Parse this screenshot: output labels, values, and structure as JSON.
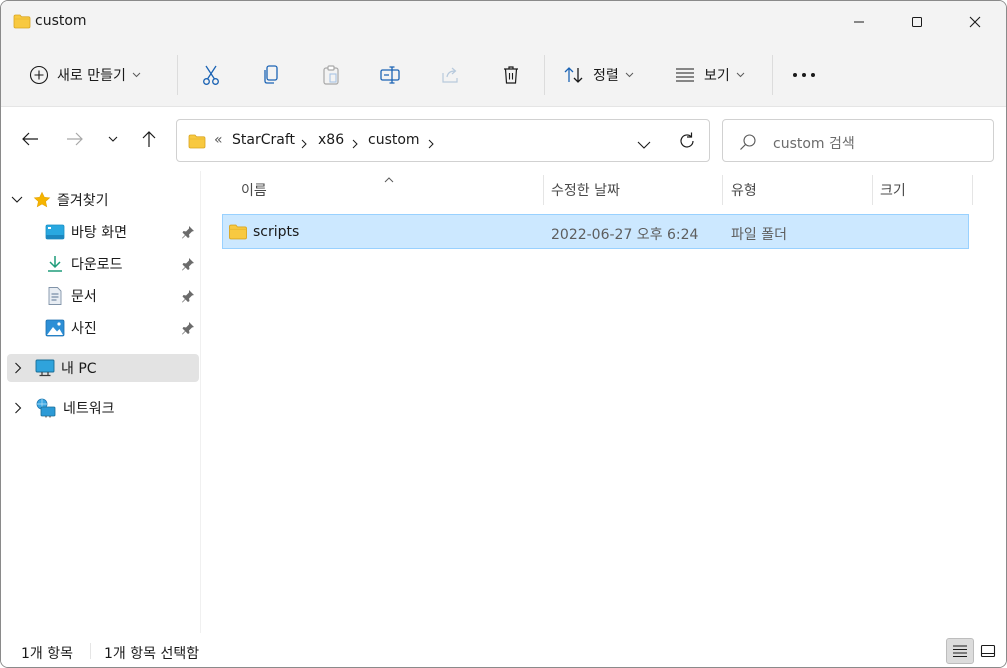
{
  "window": {
    "title": "custom"
  },
  "toolbar": {
    "new_label": "새로 만들기",
    "sort_label": "정렬",
    "view_label": "보기"
  },
  "address": {
    "overflow": "«",
    "crumbs": [
      "StarCraft",
      "x86",
      "custom"
    ]
  },
  "search": {
    "placeholder": "custom 검색"
  },
  "sidebar": {
    "quick_access": "즐겨찾기",
    "pinned": [
      {
        "label": "바탕 화면"
      },
      {
        "label": "다운로드"
      },
      {
        "label": "문서"
      },
      {
        "label": "사진"
      }
    ],
    "this_pc": "내 PC",
    "network": "네트워크"
  },
  "columns": {
    "name": "이름",
    "modified": "수정한 날짜",
    "type": "유형",
    "size": "크기"
  },
  "files": [
    {
      "name": "scripts",
      "modified": "2022-06-27 오후 6:24",
      "type": "파일 폴더",
      "size": ""
    }
  ],
  "status": {
    "count": "1개 항목",
    "selected": "1개 항목 선택함"
  },
  "colors": {
    "accent": "#0067c0",
    "folder": "#f8c940",
    "selection_bg": "#cce8ff",
    "selection_border": "#99d1ff",
    "chrome_bg": "#f3f3f3"
  }
}
